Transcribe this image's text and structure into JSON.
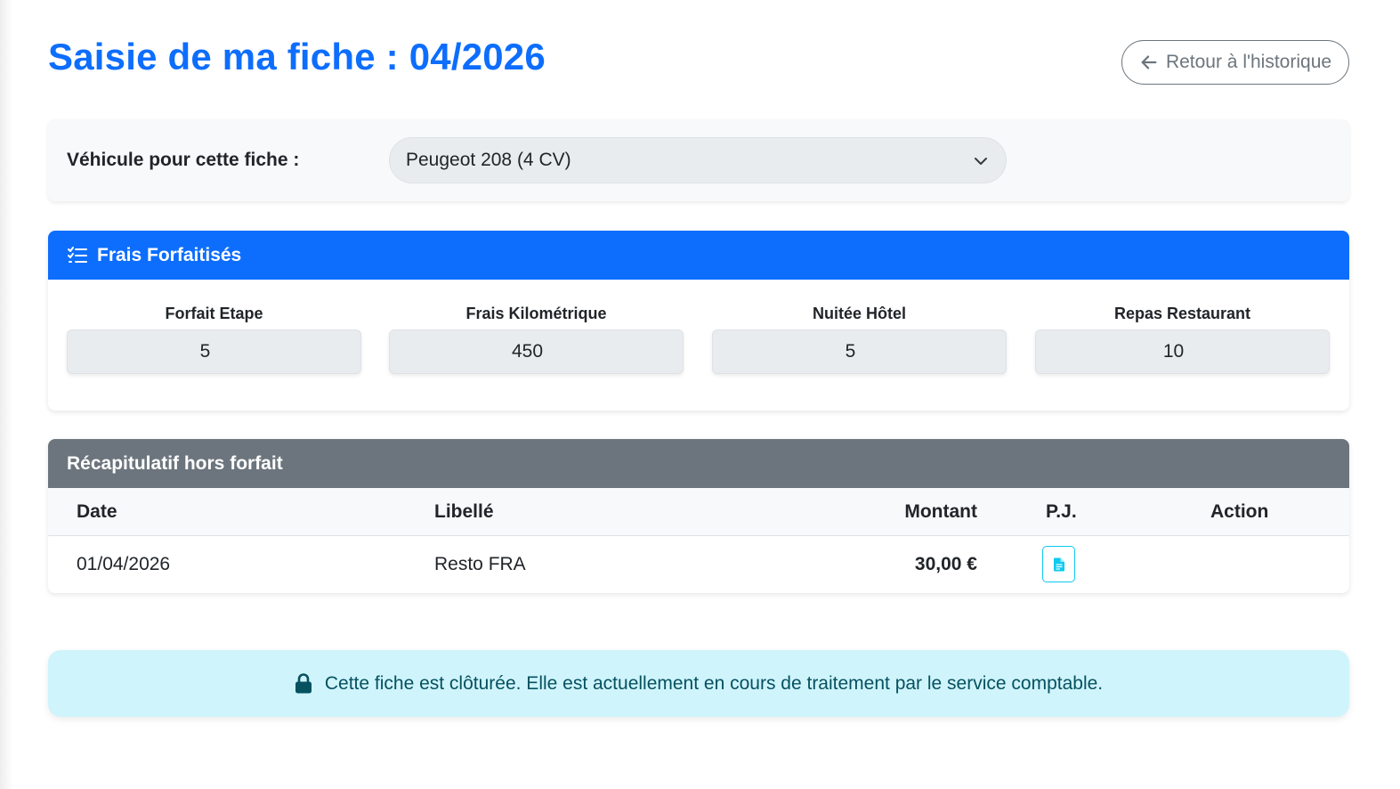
{
  "page": {
    "title": "Saisie de ma fiche : 04/2026",
    "back_button": "Retour à l'historique"
  },
  "vehicle": {
    "label": "Véhicule pour cette fiche :",
    "selected": "Peugeot 208 (4 CV)"
  },
  "forfait": {
    "header": "Frais Forfaitisés",
    "items": [
      {
        "label": "Forfait Etape",
        "value": "5"
      },
      {
        "label": "Frais Kilométrique",
        "value": "450"
      },
      {
        "label": "Nuitée Hôtel",
        "value": "5"
      },
      {
        "label": "Repas Restaurant",
        "value": "10"
      }
    ]
  },
  "recap": {
    "header": "Récapitulatif hors forfait",
    "columns": {
      "date": "Date",
      "libelle": "Libellé",
      "montant": "Montant",
      "pj": "P.J.",
      "action": "Action"
    },
    "rows": [
      {
        "date": "01/04/2026",
        "libelle": "Resto FRA",
        "montant": "30,00 €",
        "pj_icon": "file-text-icon"
      }
    ]
  },
  "alert": {
    "icon": "lock-icon",
    "text": "Cette fiche est clôturée. Elle est actuellement en cours de traitement par le service comptable."
  },
  "colors": {
    "primary": "#0d6efd",
    "secondary": "#6c757d",
    "info_bg": "#cff4fc",
    "info_text": "#055160",
    "info_border": "#0dcaf0"
  }
}
